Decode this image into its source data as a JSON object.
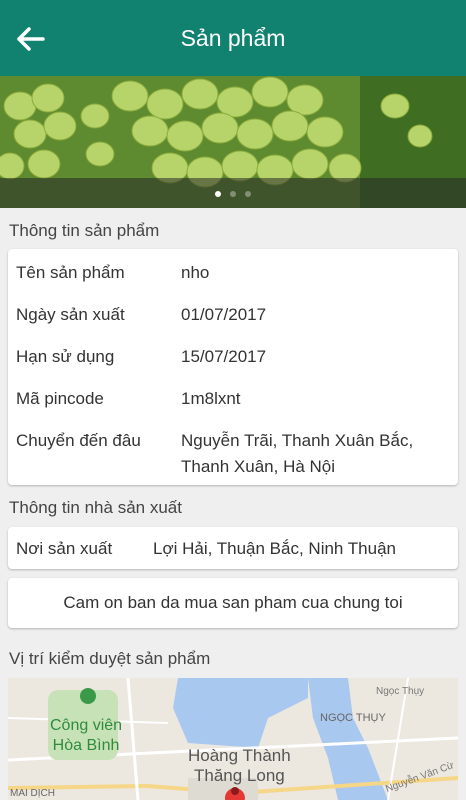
{
  "header": {
    "title": "Sản phẩm"
  },
  "product_section": {
    "title": "Thông tin sản phẩm",
    "rows": [
      {
        "label": "Tên sản phẩm",
        "value": "nho"
      },
      {
        "label": "Ngày sản xuất",
        "value": "01/07/2017"
      },
      {
        "label": "Hạn sử dụng",
        "value": "15/07/2017"
      },
      {
        "label": "Mã pincode",
        "value": "1m8lxnt"
      },
      {
        "label": "Chuyển đến đâu",
        "value": "Nguyễn Trãi, Thanh Xuân Bắc, Thanh Xuân, Hà Nội"
      }
    ]
  },
  "producer_section": {
    "title": "Thông tin nhà sản xuất",
    "origin_label": "Nơi sản xuất",
    "origin_value": "Lợi Hải, Thuận Bắc, Ninh Thuận"
  },
  "thank_you_message": "Cam on ban da mua san pham cua chung toi",
  "map_section": {
    "title": "Vị trí kiểm duyệt sản phẩm",
    "labels": {
      "park": "Công viên\nHòa Bình",
      "citadel": "Hoàng Thành\nThăng Long",
      "ngoc_thuy": "NGỌC THỤY",
      "ngoc_thuy_small": "Ngọc Thụy",
      "mai_dich": "MAI DỊCH",
      "nguyen_van_cu": "Nguyễn Văn Cừ"
    }
  },
  "colors": {
    "appbar": "#128270",
    "background": "#efefef",
    "pin": "#e53935"
  }
}
